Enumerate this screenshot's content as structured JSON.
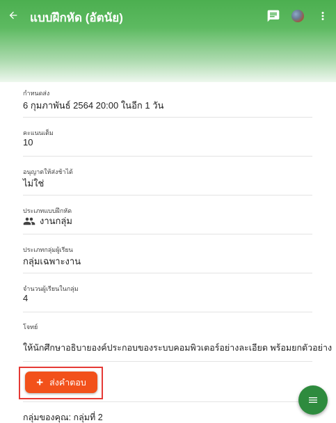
{
  "appbar": {
    "title": "แบบฝึกหัด (อัตนัย)",
    "back_icon": "arrow-back-icon",
    "message_icon": "message-icon",
    "more_icon": "more-vert-icon",
    "colors": {
      "top": "#4caf50",
      "bottom": "#eef7ee"
    }
  },
  "fields": {
    "due": {
      "label": "กำหนดส่ง",
      "value": "6 กุมภาพันธ์ 2564 20:00 ในอีก 1 วัน"
    },
    "score": {
      "label": "คะแนนเต็ม",
      "value": "10"
    },
    "late": {
      "label": "อนุญาตให้ส่งช้าได้",
      "value": "ไม่ใช่"
    },
    "type": {
      "label": "ประเภทแบบฝึกหัด",
      "value": "งานกลุ่ม",
      "icon": "group-icon"
    },
    "group_type": {
      "label": "ประเภทกลุ่มผู้เรียน",
      "value": "กลุ่มเฉพาะงาน"
    },
    "members": {
      "label": "จำนวนผู้เรียนในกลุ่ม",
      "value": "4"
    },
    "question": {
      "label": "โจทย์",
      "value": "ให้นักศึกษาอธิบายองค์ประกอบของระบบคอมพิวเตอร์อย่างละเอียด พร้อมยกตัวอย่าง"
    }
  },
  "submit": {
    "label": "ส่งคำตอบ",
    "icon": "plus-icon",
    "color": "#f2511b",
    "highlight_color": "#e53935"
  },
  "group": {
    "text": "กลุ่มของคุณ: กลุ่มที่ 2"
  },
  "fab": {
    "icon": "menu-icon",
    "color": "#2e8b3e"
  }
}
